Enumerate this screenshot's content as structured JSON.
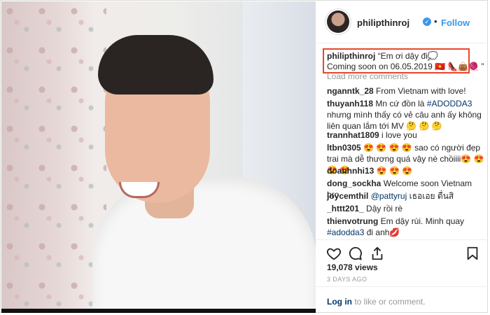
{
  "header": {
    "username": "philipthinroj",
    "verified_mark": "✓",
    "separator": "•",
    "follow_label": "Follow"
  },
  "caption": {
    "username": "philipthinroj",
    "line1": "“Em ơi dậy đi💭",
    "line2": "Coming soon on 06.05.2019 🇻🇳 👠👜🧶 ”"
  },
  "load_more_label": "Load more comments",
  "comments": [
    {
      "user": "nganntk_28",
      "text": "From Vietnam with love!"
    },
    {
      "user": "thuyanh118",
      "text": "Mn cứ đồn là",
      "tag": "#ADODDA3",
      "text2": "nhưng mình thấy có vẻ câu anh ấy không liên quan lắm tới MV 🤔 🤔 🤔"
    },
    {
      "user": "trannhat1809",
      "text": "i love you"
    },
    {
      "user": "ltbn0305",
      "text": "😍 😍 😍 😍 sao có người đẹp trai mà dễ thương quá vậy nè chồiiii😍 😍 😍 😍"
    },
    {
      "user": "doanhnhi13",
      "text": "😍 😍 😍"
    },
    {
      "user": "dong_sockha",
      "text": "Welcome soon Vietnam bro"
    },
    {
      "user": "joycemthil",
      "tag": "@pattyruj",
      "text": "เธอเอย ตื่นสิ"
    },
    {
      "user": "_httt201_",
      "text": "Dậy rồi rè"
    },
    {
      "user": "thienvotrung",
      "text": "Em dậy rùi. Minh quay",
      "tag": "#adodda3",
      "text2": "đi anh💋"
    }
  ],
  "views": "19,078 views",
  "date": "3 DAYS AGO",
  "login": {
    "link": "Log in",
    "text": " to like or comment."
  },
  "icons": [
    "heart-icon",
    "comment-icon",
    "share-icon",
    "bookmark-icon"
  ],
  "colors": {
    "accent": "#3897f0",
    "highlight_box": "#e8452c",
    "tag": "#003569"
  }
}
